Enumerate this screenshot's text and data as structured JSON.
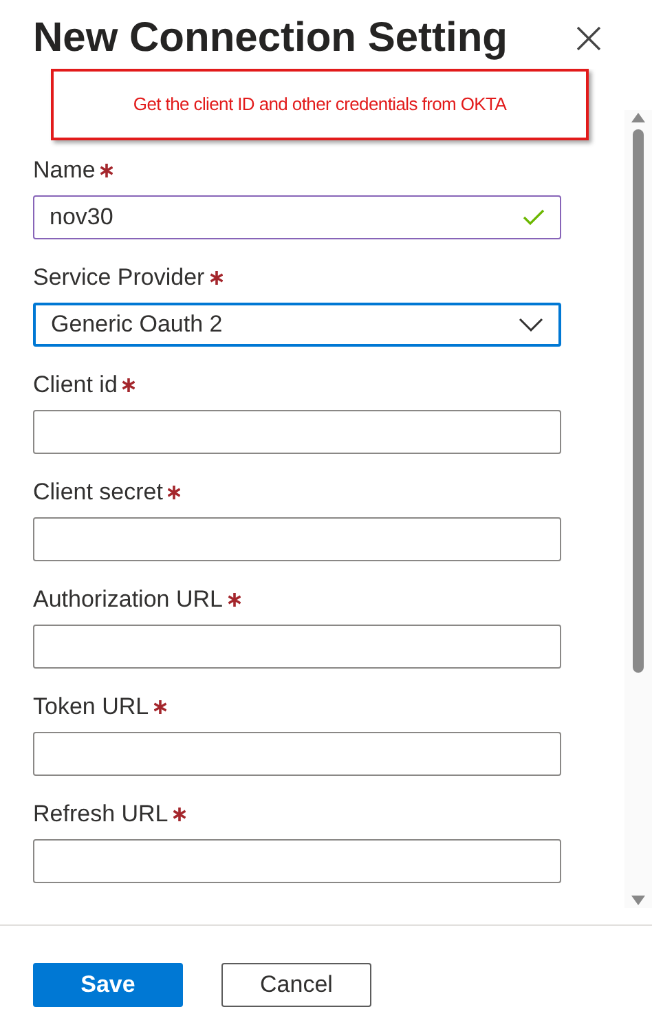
{
  "title": "New Connection Setting",
  "callout": "Get the client ID and other credentials from OKTA",
  "fields": [
    {
      "kind": "text",
      "label": "Name",
      "required": true,
      "value": "nov30",
      "valid": true,
      "focused": false
    },
    {
      "kind": "select",
      "label": "Service Provider",
      "required": true,
      "value": "Generic Oauth 2",
      "valid": false,
      "focused": true
    },
    {
      "kind": "text",
      "label": "Client id",
      "required": true,
      "valid": false,
      "focused": false
    },
    {
      "kind": "text",
      "label": "Client secret",
      "required": true,
      "valid": false,
      "focused": false
    },
    {
      "kind": "text",
      "label": "Authorization URL",
      "required": true,
      "valid": false,
      "focused": false
    },
    {
      "kind": "text",
      "label": "Token URL",
      "required": true,
      "valid": false,
      "focused": false
    },
    {
      "kind": "text",
      "label": "Refresh URL",
      "required": true,
      "valid": false,
      "focused": false
    }
  ],
  "buttons": [
    {
      "label": "Save",
      "kind": "primary"
    },
    {
      "label": "Cancel",
      "kind": "secondary"
    }
  ]
}
